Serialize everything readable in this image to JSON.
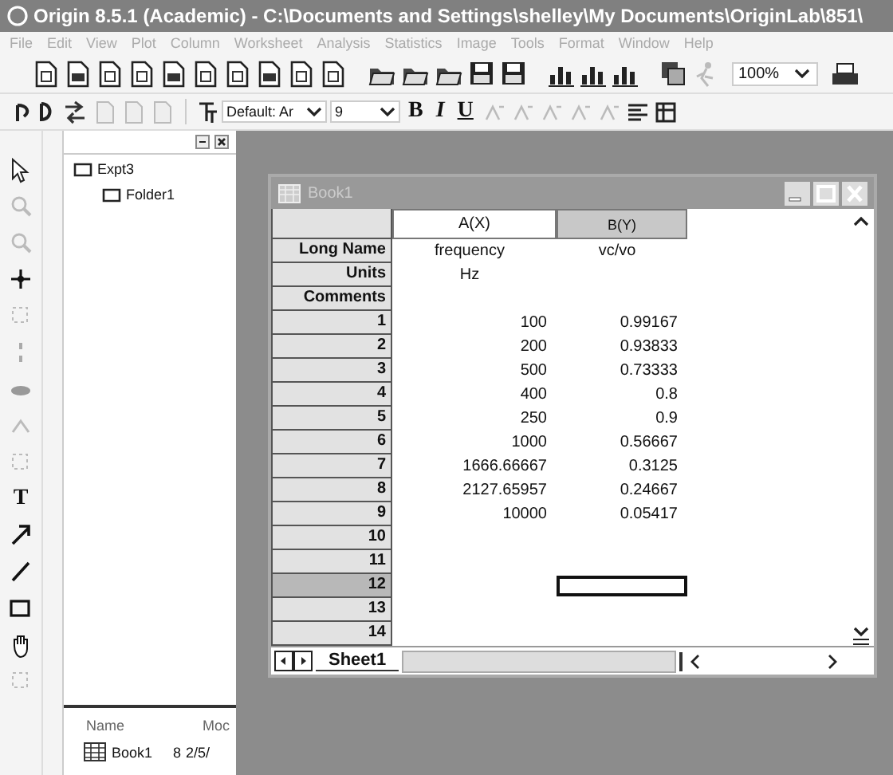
{
  "window": {
    "title": "Origin 8.5.1 (Academic) - C:\\Documents and Settings\\shelley\\My Documents\\OriginLab\\851\\"
  },
  "menu": [
    "File",
    "Edit",
    "View",
    "Plot",
    "Column",
    "Worksheet",
    "Analysis",
    "Statistics",
    "Image",
    "Tools",
    "Format",
    "Window",
    "Help"
  ],
  "toolbar": {
    "zoom": "100%"
  },
  "format_bar": {
    "font": "Default: Ar",
    "size": "9",
    "bold": "B",
    "italic": "I",
    "underline": "U"
  },
  "tools": [
    {
      "kind": "pointer"
    },
    {
      "kind": "zoom"
    },
    {
      "kind": "zoom"
    },
    {
      "kind": "crosshair"
    },
    {
      "kind": "select"
    },
    {
      "kind": "pick"
    },
    {
      "kind": "brush"
    },
    {
      "kind": "mask"
    },
    {
      "kind": "select"
    },
    {
      "kind": "text",
      "label": "T"
    },
    {
      "kind": "arrow"
    },
    {
      "kind": "line"
    },
    {
      "kind": "rect"
    },
    {
      "kind": "hand"
    },
    {
      "kind": "select"
    }
  ],
  "project_explorer": {
    "tree": [
      {
        "label": "Expt3",
        "children": [
          {
            "label": "Folder1"
          }
        ]
      }
    ],
    "columns": [
      "Name",
      "Moc"
    ],
    "items": [
      {
        "name": "Book1",
        "column_2": "8",
        "column_3": "2/5/"
      }
    ]
  },
  "book": {
    "title": "Book1",
    "columns": [
      {
        "header": "A(X)",
        "long_name": "frequency",
        "units": "Hz",
        "selected": false
      },
      {
        "header": "B(Y)",
        "long_name": "vc/vo",
        "selected": true
      }
    ],
    "meta_labels": [
      "Long Name",
      "Units",
      "Comments"
    ],
    "rows": [
      {
        "label": "1",
        "a": "100",
        "b": "0.99167",
        "selected": false
      },
      {
        "label": "2",
        "a": "200",
        "b": "0.93833",
        "selected": false
      },
      {
        "label": "3",
        "a": "500",
        "b": "0.73333",
        "selected": false
      },
      {
        "label": "4",
        "a": "400",
        "b": "0.8",
        "selected": false
      },
      {
        "label": "5",
        "a": "250",
        "b": "0.9",
        "selected": false
      },
      {
        "label": "6",
        "a": "1000",
        "b": "0.56667",
        "selected": false
      },
      {
        "label": "7",
        "a": "1666.66667",
        "b": "0.3125",
        "selected": false
      },
      {
        "label": "8",
        "a": "2127.65957",
        "b": "0.24667",
        "selected": false
      },
      {
        "label": "9",
        "a": "10000",
        "b": "0.05417",
        "selected": false
      },
      {
        "label": "10",
        "selected": false
      },
      {
        "label": "11",
        "selected": false
      },
      {
        "label": "12",
        "selected": true
      },
      {
        "label": "13",
        "selected": false
      },
      {
        "label": "14",
        "selected": false
      }
    ],
    "sheets": [
      {
        "label": "Sheet1"
      }
    ]
  }
}
